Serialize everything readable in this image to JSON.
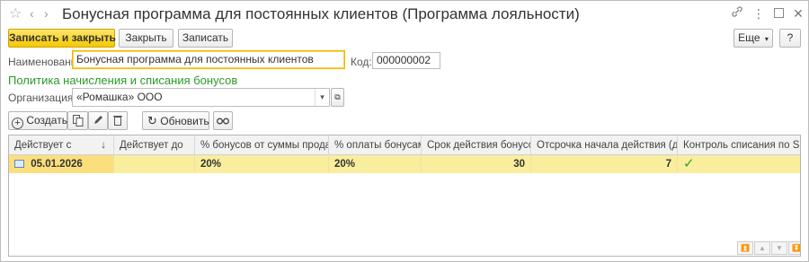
{
  "window": {
    "title": "Бонусная программа для постоянных клиентов (Программа лояльности)"
  },
  "commands": {
    "save_close": "Записать и закрыть",
    "close": "Закрыть",
    "save": "Записать",
    "more": "Еще",
    "help": "?"
  },
  "form": {
    "name_label": "Наименование:",
    "name_value": "Бонусная программа для постоянных клиентов",
    "code_label": "Код:",
    "code_value": "000000002",
    "section_title": "Политика начисления и списания бонусов",
    "org_label": "Организация:",
    "org_value": "«Ромашка» ООО"
  },
  "table_toolbar": {
    "create": "Создать",
    "refresh": "Обновить"
  },
  "table": {
    "columns": [
      "Действует с",
      "Действует до",
      "% бонусов от суммы продажи",
      "% оплаты бонусами",
      "Срок действия бонусов",
      "Отсрочка начала действия (дней)",
      "Контроль списания по SMS"
    ],
    "sort_indicator": "↓",
    "rows": [
      {
        "from": "05.01.2026",
        "to": "",
        "bonus_pct": "20%",
        "pay_pct": "20%",
        "validity": "30",
        "delay": "7",
        "sms_control": "✓"
      }
    ]
  },
  "colors": {
    "primary_button": "#f5c800",
    "selected_row": "#f9ee9d",
    "section_title": "#2a9a2a"
  }
}
